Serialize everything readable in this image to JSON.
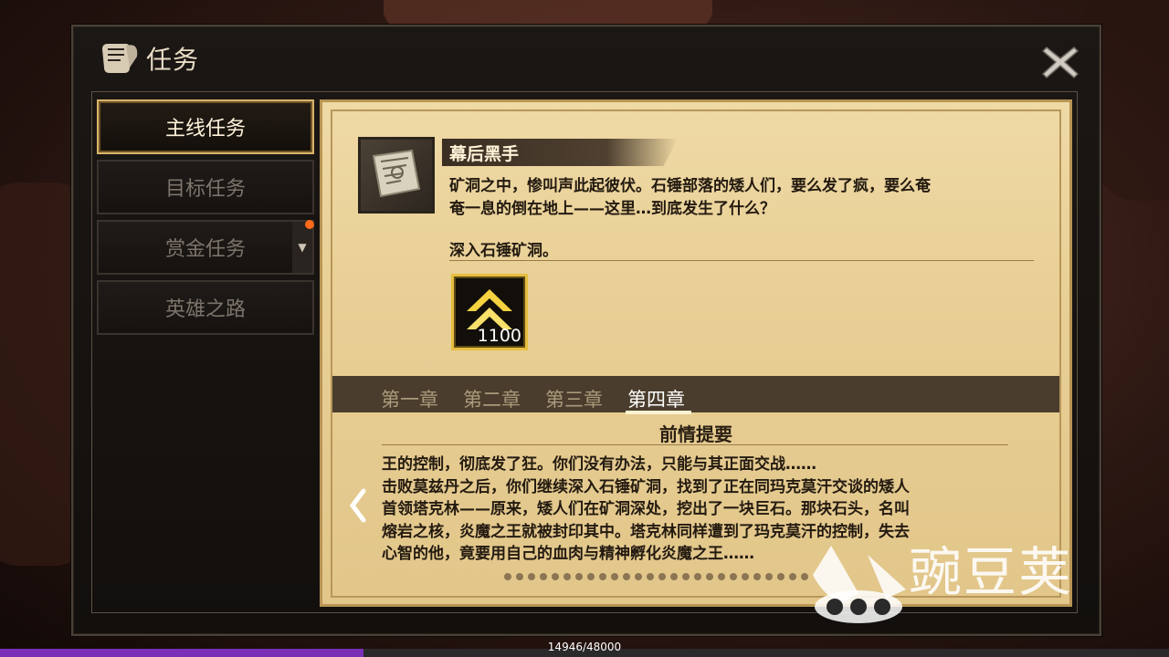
{
  "window": {
    "title": "任务"
  },
  "tabs": [
    {
      "label": "主线任务",
      "active": true
    },
    {
      "label": "目标任务",
      "active": false
    },
    {
      "label": "赏金任务",
      "active": false,
      "badge": true
    },
    {
      "label": "英雄之路",
      "active": false
    }
  ],
  "quest": {
    "title": "幕后黑手",
    "description_line1": "矿洞之中，惨叫声此起彼伏。石锤部落的矮人们，要么发了疯，要么奄",
    "description_line2": "奄一息的倒在地上——这里…到底发生了什么？",
    "objective": "深入石锤矿洞。",
    "reward": {
      "icon": "rank-chevron-icon",
      "count": "1100"
    }
  },
  "chapters": [
    {
      "label": "第一章",
      "active": false
    },
    {
      "label": "第二章",
      "active": false
    },
    {
      "label": "第三章",
      "active": false
    },
    {
      "label": "第四章",
      "active": true
    }
  ],
  "summary": {
    "title": "前情提要",
    "lines": [
      "王的控制，彻底发了狂。你们没有办法，只能与其正面交战……",
      "击败莫兹丹之后，你们继续深入石锤矿洞，找到了正在同玛克莫汗交谈的矮人",
      "首领塔克林——原来，矮人们在矿洞深处，挖出了一块巨石。那块石头，名叫",
      "熔岩之核，炎魔之王就被封印其中。塔克林同样遭到了玛克莫汗的控制，失去",
      "心智的他，竟要用自己的血肉与精神孵化炎魔之王……"
    ]
  },
  "xp": {
    "text": "14946/48000",
    "fraction": 0.311
  },
  "watermark": {
    "text": "豌豆荚"
  },
  "colors": {
    "accent": "#d9b56a",
    "xp": "#7b2fb7",
    "badge": "#ff6a1a"
  }
}
